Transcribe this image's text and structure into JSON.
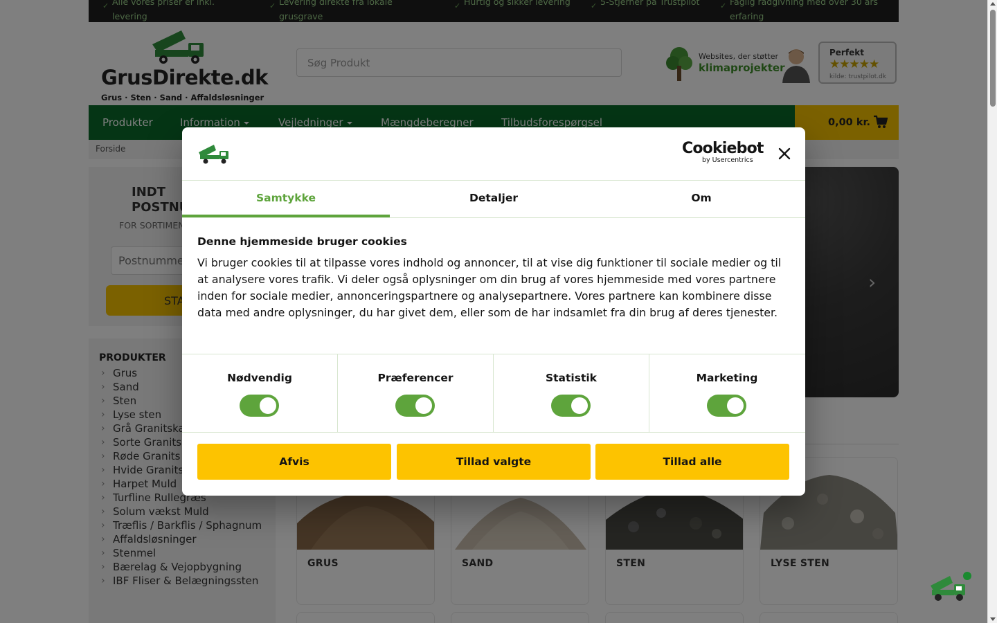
{
  "topbar": {
    "usps": [
      "Alle vores priser er inkl. levering",
      "Levering direkte fra lokale grusgrave",
      "Hurtig og sikker levering",
      "5-Stjerner på Trustpilot",
      "Faglig rådgivning med over 30 års erfaring"
    ]
  },
  "header": {
    "logo_name": "GrusDirekte.dk",
    "logo_tagline": "Grus · Sten · Sand · Affaldsløsninger",
    "search_placeholder": "Søg Produkt",
    "klima_small": "Websites, der støtter",
    "klima_big": "klimaprojekter",
    "trust_title": "Perfekt",
    "trust_stars": "★★★★★",
    "trust_source": "kilde: trustpilot.dk"
  },
  "nav": {
    "items": [
      "Produkter",
      "Information",
      "Vejledninger",
      "Mængdeberegner",
      "Tilbudsforespørgsel"
    ],
    "cart_total": "0,00 kr."
  },
  "breadcrumb": "Forside",
  "postal": {
    "title": "INDT\nPOSTNU",
    "subtitle": "FOR SORTIMEN",
    "input_placeholder": "Postnummer",
    "button_label": "STA"
  },
  "sidebar": {
    "title": "PRODUKTER",
    "items": [
      "Grus",
      "Sand",
      "Sten",
      "Lyse sten",
      "Grå Granitska",
      "Sorte Granits",
      "Røde Granits",
      "Hvide Granits",
      "Harpet Muld",
      "Turfline Rullegræs",
      "Solum vækst Muld",
      "Træflis / Barkflis / Sphagnum",
      "Affaldsløsninger",
      "Stenmel",
      "Bærelag & Vejopbygning",
      "IBF Fliser & Belægningssten"
    ]
  },
  "products": [
    {
      "name": "GRUS"
    },
    {
      "name": "SAND"
    },
    {
      "name": "STEN"
    },
    {
      "name": "LYSE STEN"
    }
  ],
  "cookie": {
    "brand": "Cookiebot",
    "brand_sub": "by Usercentrics",
    "tabs": [
      "Samtykke",
      "Detaljer",
      "Om"
    ],
    "title": "Denne hjemmeside bruger cookies",
    "text": "Vi bruger cookies til at tilpasse vores indhold og annoncer, til at vise dig funktioner til sociale medier og til at analysere vores trafik. Vi deler også oplysninger om din brug af vores hjemmeside med vores partnere inden for sociale medier, annonceringspartnere og analysepartnere. Vores partnere kan kombinere disse data med andre oplysninger, du har givet dem, eller som de har indsamlet fra din brug af deres tjenester.",
    "categories": [
      "Nødvendig",
      "Præferencer",
      "Statistik",
      "Marketing"
    ],
    "buttons": {
      "reject": "Afvis",
      "allow_selected": "Tillad valgte",
      "allow_all": "Tillad alle"
    },
    "colors": {
      "accent_green": "#5ea43c",
      "button_yellow": "#fdc300"
    }
  },
  "colors": {
    "nav_green": "#0b6b2b",
    "cart_yellow": "#f7c200",
    "topbar": "#1e1e1e"
  }
}
